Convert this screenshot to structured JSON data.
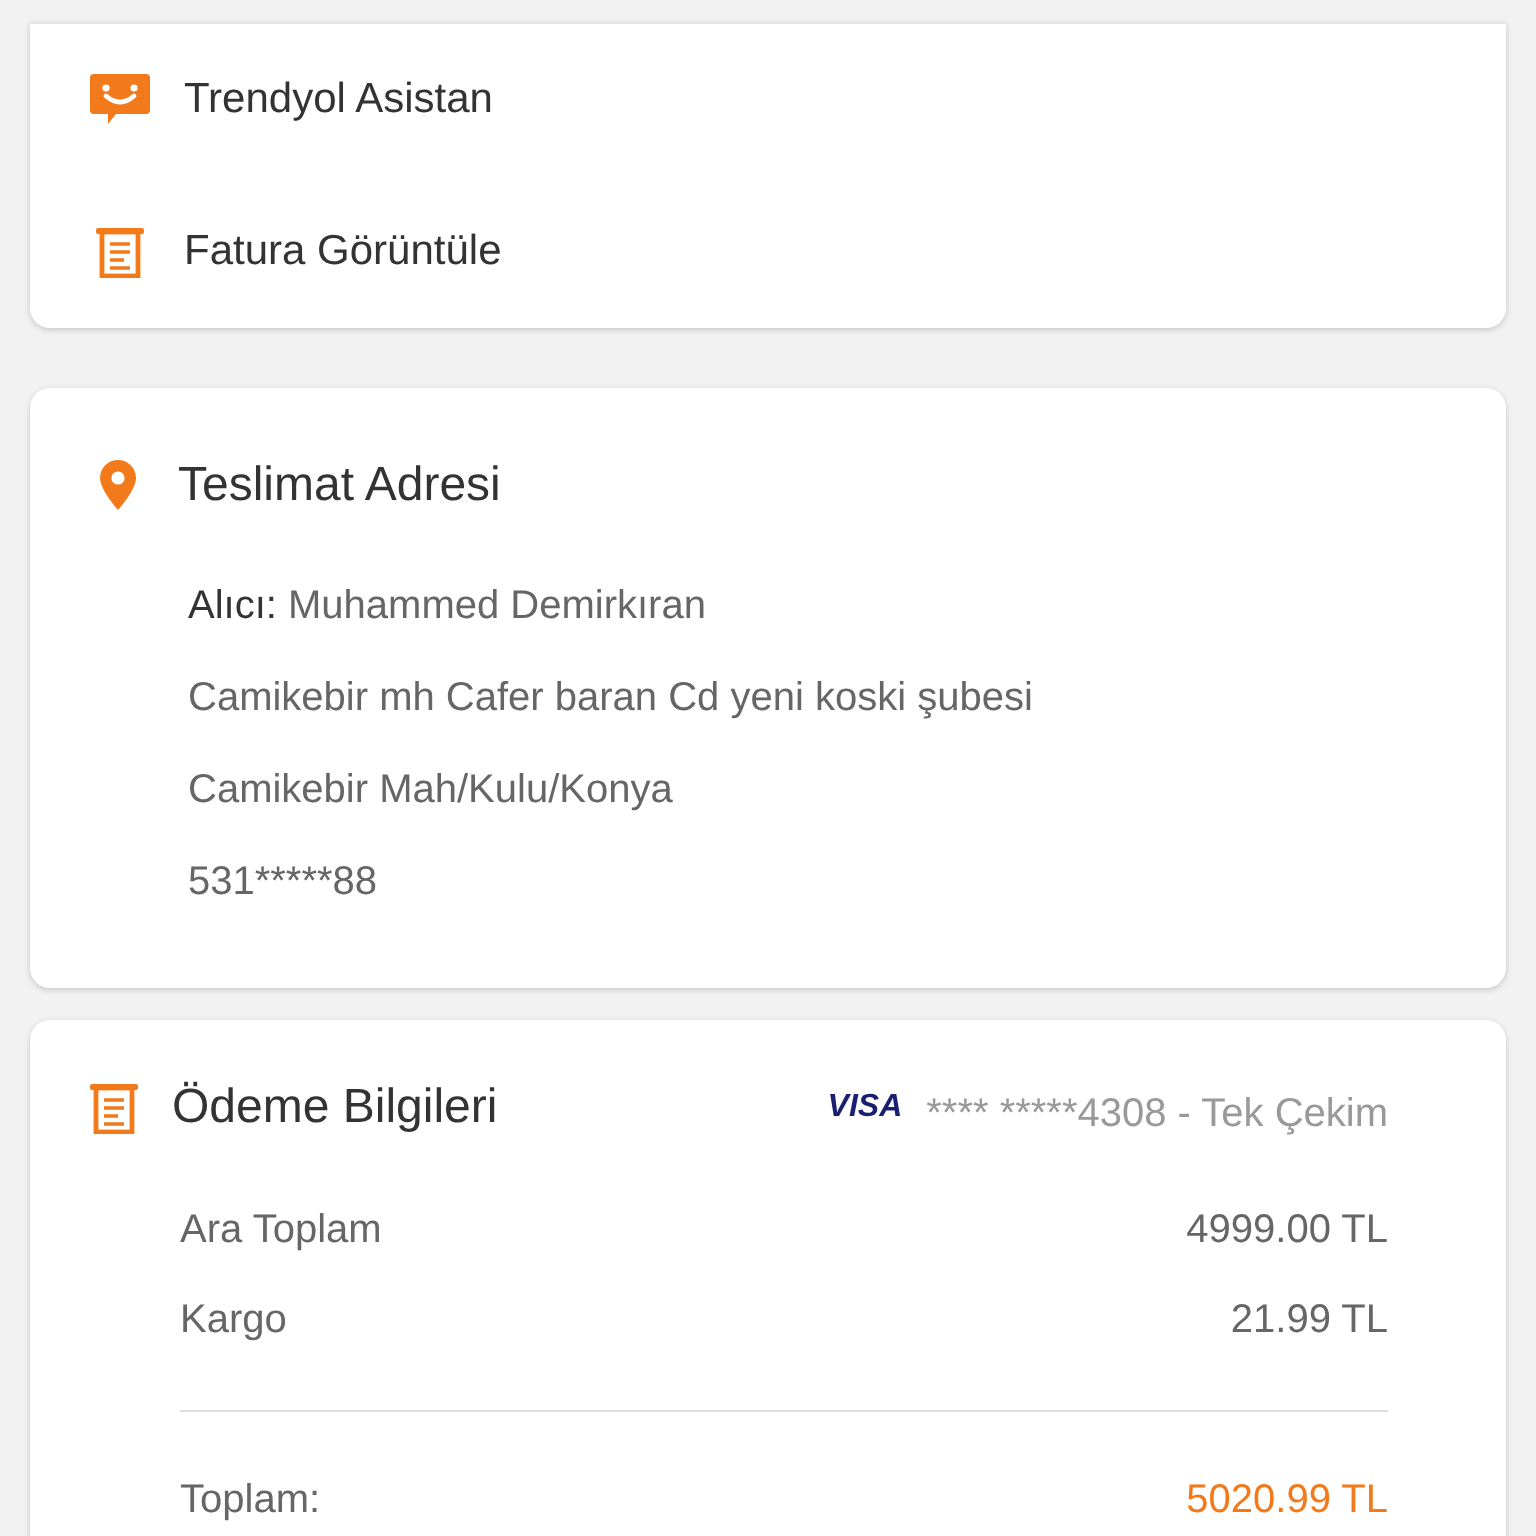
{
  "actions": [
    {
      "kind": "assistant",
      "label": "Trendyol Asistan"
    },
    {
      "kind": "invoice",
      "label": "Fatura Görüntüle"
    }
  ],
  "address": {
    "title": "Teslimat Adresi",
    "recipient_label": "Alıcı:",
    "recipient": "Muhammed Demirkıran",
    "lines": [
      "Camikebir mh Cafer baran Cd yeni koski şubesi",
      "Camikebir Mah/Kulu/Konya"
    ],
    "phone": "531*****88"
  },
  "payment": {
    "title": "Ödeme Bilgileri",
    "card_brand": "VISA",
    "card_info": "**** *****4308 - Tek Çekim",
    "rows": [
      {
        "label": "Ara Toplam",
        "value": "4999.00 TL"
      },
      {
        "label": "Kargo",
        "value": "21.99 TL"
      }
    ],
    "total": {
      "label": "Toplam:",
      "value": "5020.99 TL"
    }
  }
}
